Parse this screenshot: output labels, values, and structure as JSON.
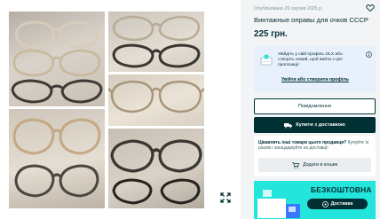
{
  "listing": {
    "date": "Опубліковано 29 серпня 2025 р.",
    "title": "Винтажные оправы для очков СССР",
    "price": "225 грн."
  },
  "promo": {
    "text": "Увійдіть у свій профіль OLX або створіть новий, щоб вийти з цієї пропозиції",
    "link": "Увійти або створити профіль"
  },
  "actions": {
    "message_label": "Повідомлення",
    "buy_label": "Купити з доставкою"
  },
  "cart": {
    "bold_text": "Цікавлять інші товари цього продавця?",
    "text": "Купуйте їх разом і заощаджуйте на доставці!",
    "button_label": "Додати в кошик"
  },
  "banner": {
    "title": "БЕЗКОШТОВНА",
    "pill_label": "Доставка"
  },
  "colors": {
    "primary": "#002f34",
    "banner": "#23e5db",
    "promo_bg": "#e8f0fb"
  },
  "icons": [
    "heart-icon",
    "expand-icon",
    "info-icon",
    "truck-icon",
    "cart-icon",
    "olx-delivery-icon"
  ]
}
